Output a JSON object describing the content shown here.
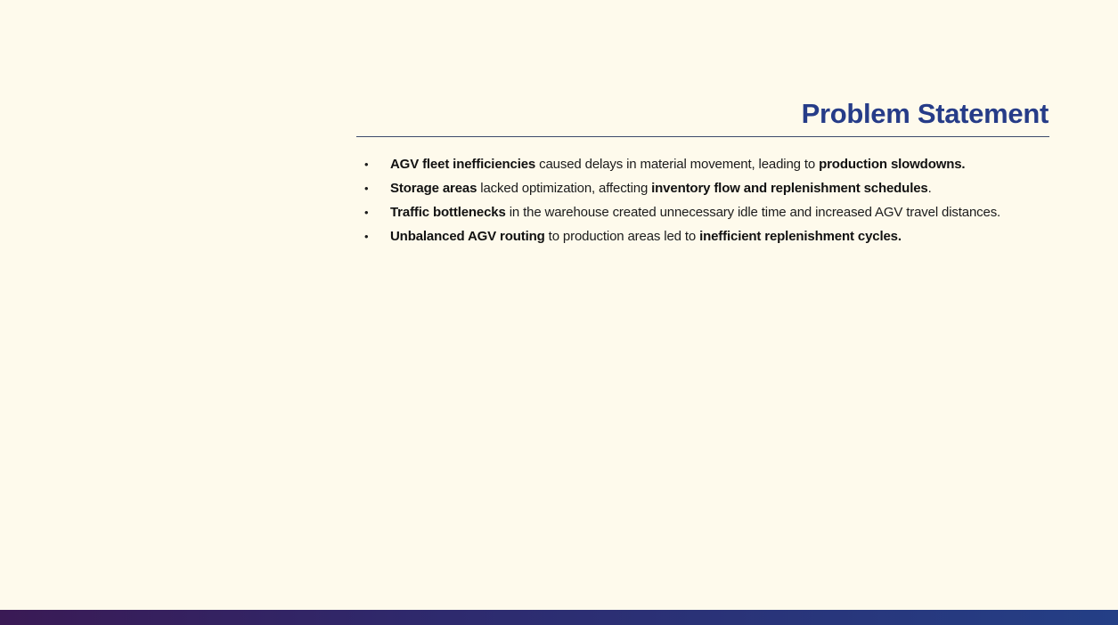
{
  "slide": {
    "title": "Problem Statement",
    "colors": {
      "title": "#263c88",
      "background": "#fefaec",
      "footer_start": "#3a1a55",
      "footer_end": "#243f86"
    },
    "bullet_glyph": "•",
    "bullets": [
      {
        "b1": "AGV fleet inefficiencies",
        "t1": " caused delays in material movement, leading to ",
        "b2": "production slowdowns.",
        "t2": ""
      },
      {
        "b1": "Storage areas",
        "t1": " lacked optimization, affecting ",
        "b2": "inventory flow and replenishment schedules",
        "t2": "."
      },
      {
        "b1": "Traffic bottlenecks",
        "t1": " in the warehouse created unnecessary idle time and increased AGV travel distances.",
        "b2": "",
        "t2": ""
      },
      {
        "b1": "Unbalanced AGV routing",
        "t1": " to production areas led to ",
        "b2": "inefficient replenishment cycles.",
        "t2": ""
      }
    ]
  }
}
